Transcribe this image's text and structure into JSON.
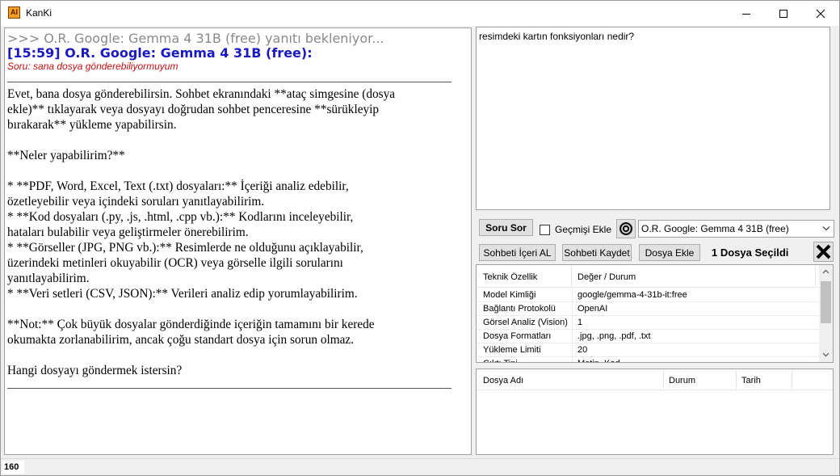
{
  "window": {
    "icon_text": "AI",
    "title": "KanKi"
  },
  "chat": {
    "waiting": ">>> O.R. Google: Gemma 4 31B (free) yanıtı bekleniyor...",
    "header": "[15:59] O.R. Google: Gemma 4 31B (free):",
    "question": "Soru: sana dosya gönderebiliyormuyum",
    "lines": [
      "Evet, bana dosya gönderebilirsin. Sohbet ekranındaki **ataç simgesine (dosya",
      "ekle)** tıklayarak veya dosyayı doğrudan sohbet penceresine **sürükleyip",
      "bırakarak** yükleme yapabilirsin.",
      "",
      "**Neler yapabilirim?**",
      "",
      "*   **PDF, Word, Excel, Text (.txt) dosyaları:** İçeriği analiz edebilir,",
      "özetleyebilir veya içindeki soruları yanıtlayabilirim.",
      "*   **Kod dosyaları (.py, .js, .html, .cpp vb.):** Kodlarını inceleyebilir,",
      "hataları bulabilir veya geliştirmeler önerebilirim.",
      "*   **Görseller (JPG, PNG vb.):** Resimlerde ne olduğunu açıklayabilir,",
      "üzerindeki metinleri okuyabilir (OCR) veya görselle ilgili sorularını",
      "yanıtlayabilirim.",
      "*   **Veri setleri (CSV, JSON):** Verileri analiz edip yorumlayabilirim.",
      "",
      "**Not:** Çok büyük dosyalar gönderdiğinde içeriğin tamamını bir kerede",
      "okumakta zorlanabilirim, ancak çoğu standart dosya için sorun olmaz.",
      "",
      "Hangi dosyayı göndermek istersin?"
    ]
  },
  "status": {
    "count": "160"
  },
  "question_input": {
    "value": "resimdeki kartın fonksiyonları nedir?"
  },
  "controls": {
    "ask_button": "Soru Sor",
    "history_label": "Geçmişi Ekle",
    "history_checked": false,
    "model_selected": "O.R. Google: Gemma 4 31B (free)",
    "import_chat_button": "Sohbeti İçeri AL",
    "save_chat_button": "Sohbeti Kaydet",
    "add_file_button": "Dosya Ekle",
    "file_selected_text": "1 Dosya Seçildi"
  },
  "spec_table": {
    "headers": [
      "Teknik Özellik",
      "Değer / Durum"
    ],
    "rows": [
      [
        "Model Kimliği",
        "google/gemma-4-31b-it:free"
      ],
      [
        "Bağlantı Protokolü",
        "OpenAI"
      ],
      [
        "Görsel Analiz (Vision)",
        "1"
      ],
      [
        "Dosya Formatları",
        ".jpg, .png, .pdf, .txt"
      ],
      [
        "Yükleme Limiti",
        "20"
      ],
      [
        "Çıktı Tipi",
        "Metin, Kod"
      ]
    ]
  },
  "files_table": {
    "headers": [
      "Dosya Adı",
      "Durum",
      "Tarih"
    ]
  },
  "colors": {
    "header_blue": "#1a1ac0",
    "question_red": "#c01010",
    "waiting_gray": "#8a8a8a"
  }
}
